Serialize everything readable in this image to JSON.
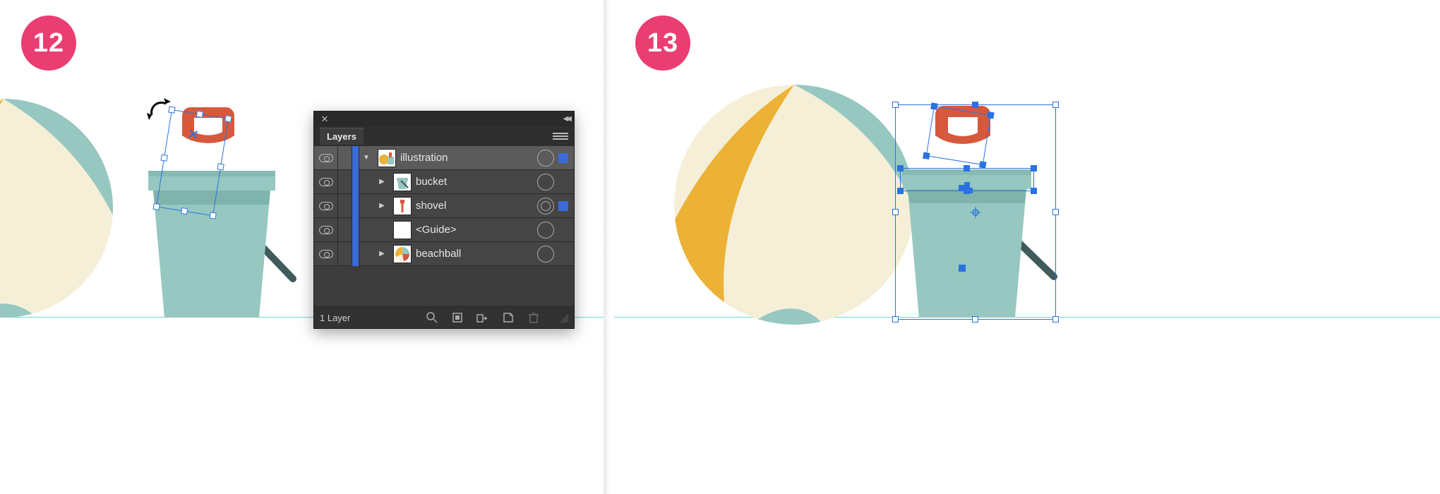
{
  "steps": {
    "left": "12",
    "right": "13"
  },
  "colors": {
    "badge": "#ea3d72",
    "teal": "#97c7c1",
    "teal_dark": "#6fa69f",
    "cream": "#f5efd8",
    "orange": "#d6593d",
    "yellow": "#ecb235",
    "handle": "#3f5b5b",
    "selection": "#2a72e0"
  },
  "layers_panel": {
    "title": "Layers",
    "footer_count": "1 Layer",
    "rows": [
      {
        "name": "illustration",
        "expanded": true,
        "level": 0,
        "selected_mark": true,
        "target": "ring",
        "thumb": "illustration",
        "visible": true
      },
      {
        "name": "bucket",
        "expanded": false,
        "level": 1,
        "selected_mark": false,
        "target": "ring",
        "thumb": "bucket",
        "visible": true
      },
      {
        "name": "shovel",
        "expanded": false,
        "level": 1,
        "selected_mark": true,
        "target": "double",
        "thumb": "shovel",
        "visible": true
      },
      {
        "name": "<Guide>",
        "expanded": null,
        "level": 1,
        "selected_mark": false,
        "target": "ring",
        "thumb": "blank",
        "visible": true
      },
      {
        "name": "beachball",
        "expanded": false,
        "level": 1,
        "selected_mark": false,
        "target": "ring",
        "thumb": "beachball",
        "visible": true
      }
    ],
    "footer_icons": [
      "search-icon",
      "locate-icon",
      "clip-icon",
      "new-layer-icon",
      "trash-icon"
    ]
  }
}
